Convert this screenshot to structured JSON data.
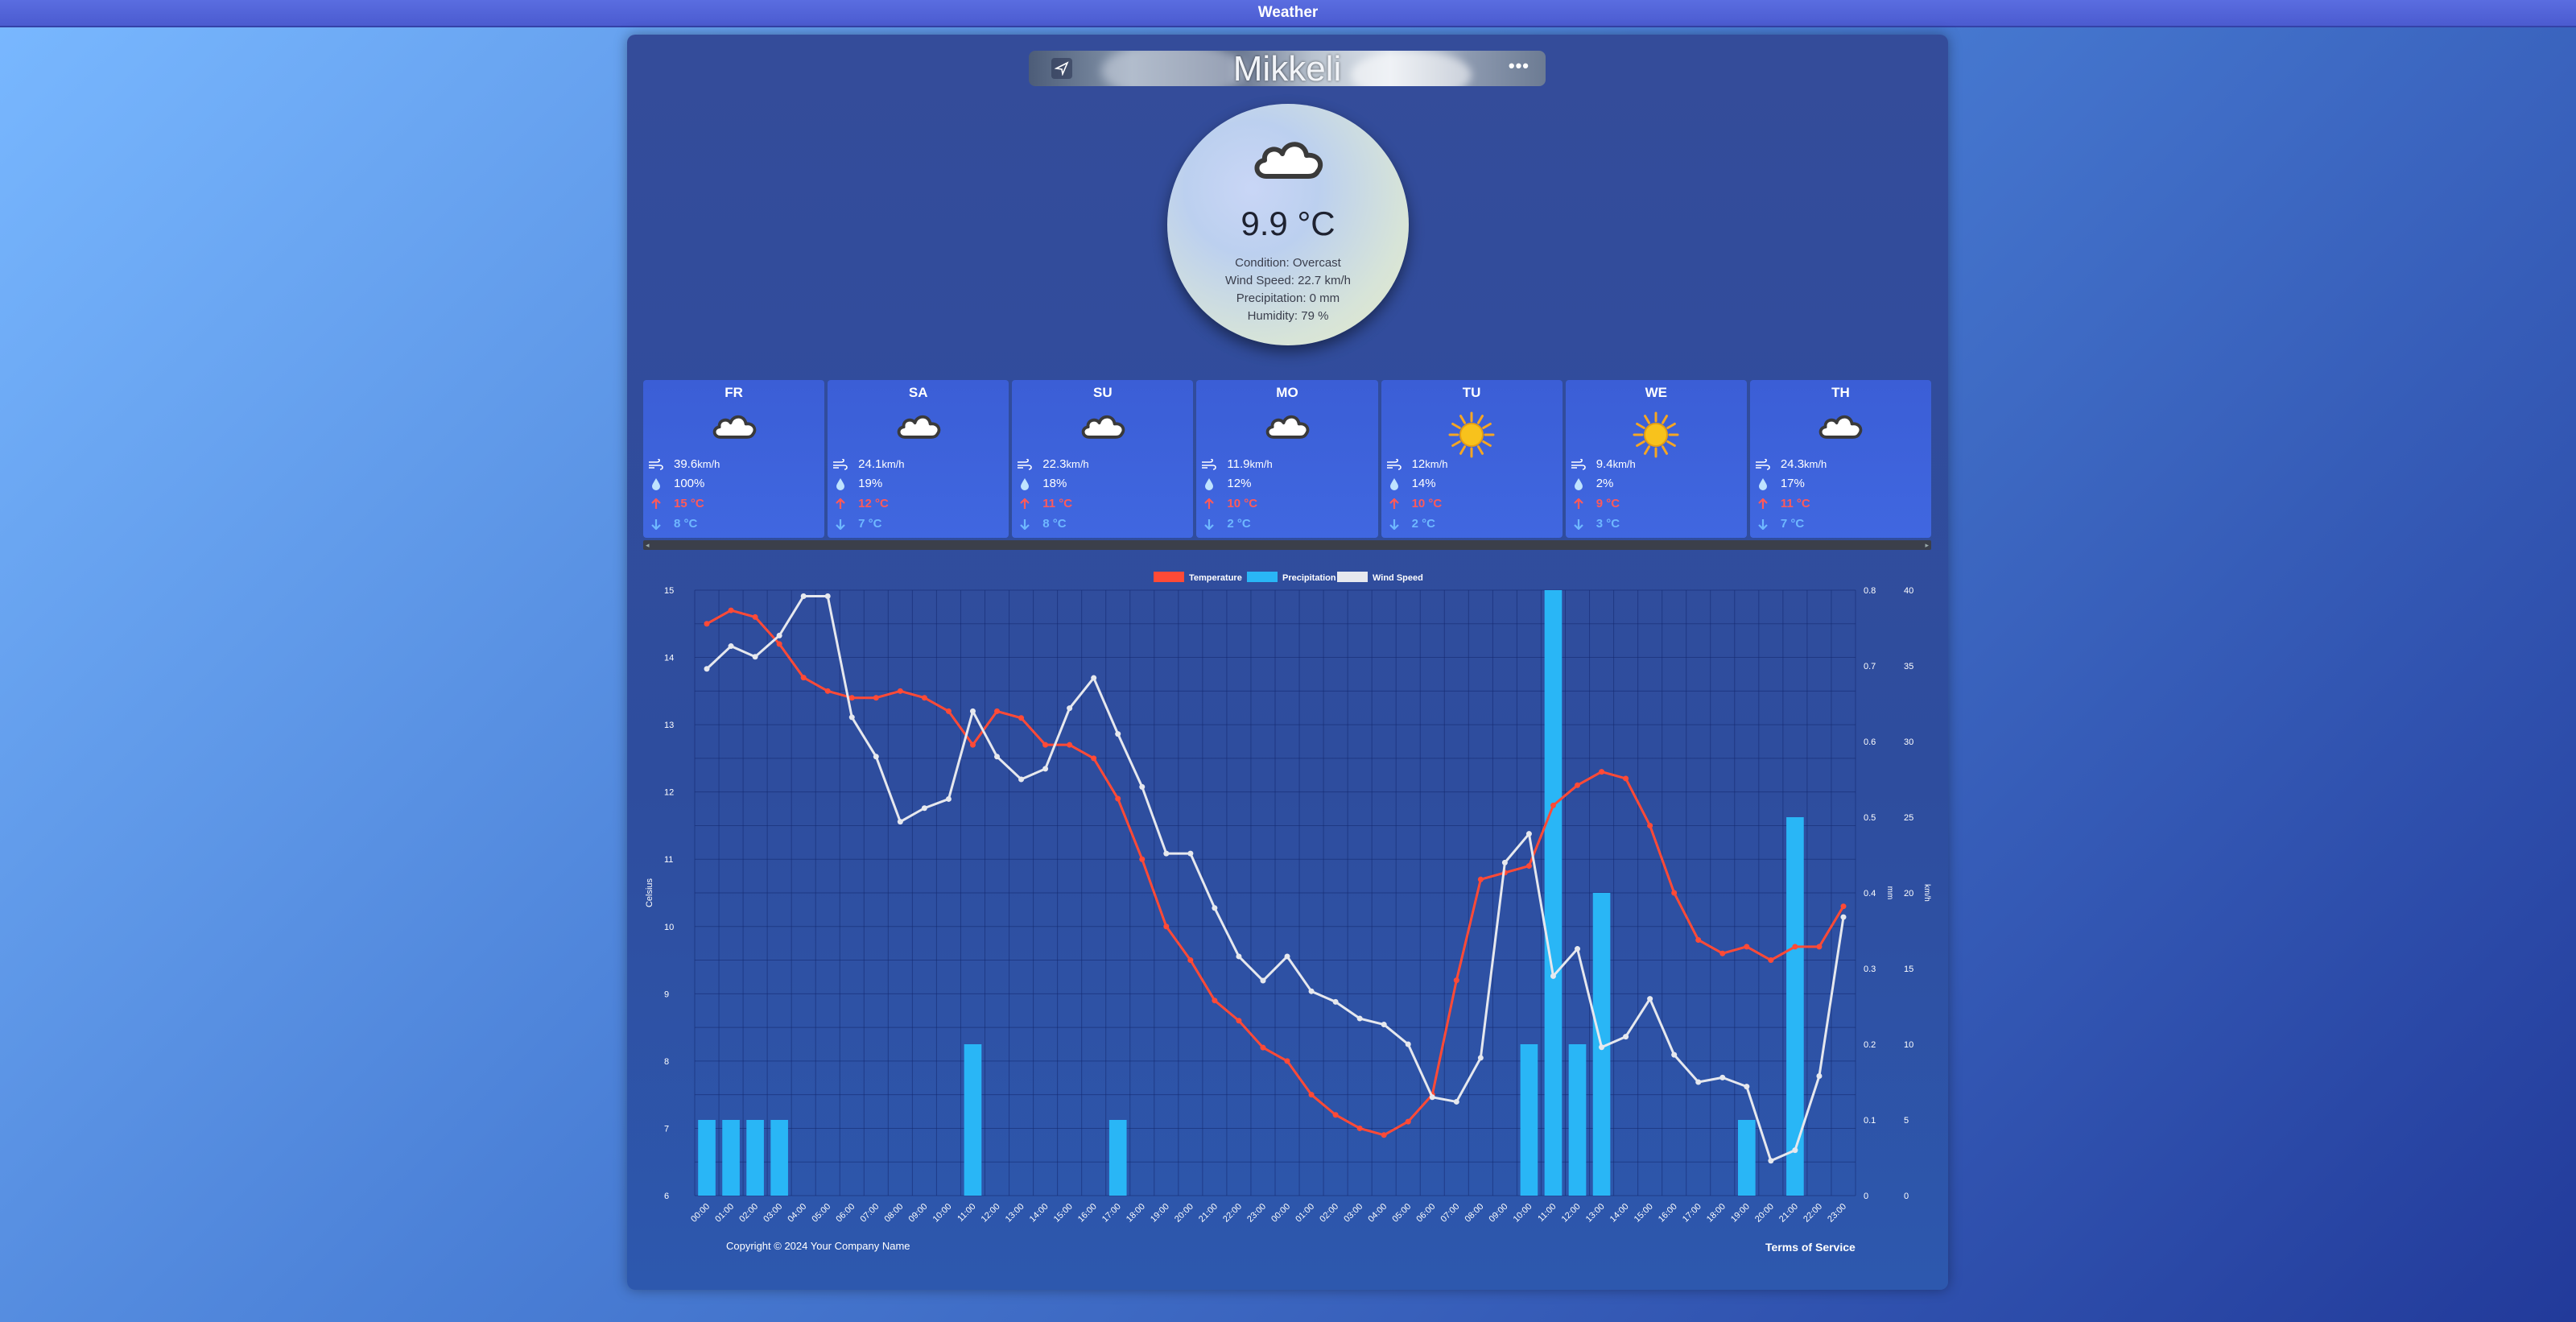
{
  "app": {
    "title": "Weather"
  },
  "search": {
    "city": "Mikkeli"
  },
  "current": {
    "temperature": "9.9 °C",
    "condition": "Condition: Overcast",
    "wind": "Wind Speed: 22.7 km/h",
    "precipitation": "Precipitation: 0 mm",
    "humidity": "Humidity: 79 %",
    "icon": "cloud-icon"
  },
  "forecast": [
    {
      "day": "FR",
      "icon": "cloud-icon",
      "wind": "39.6",
      "wind_unit": "km/h",
      "precip": "100%",
      "high": "15 °C",
      "low": "8 °C"
    },
    {
      "day": "SA",
      "icon": "cloud-icon",
      "wind": "24.1",
      "wind_unit": "km/h",
      "precip": "19%",
      "high": "12 °C",
      "low": "7 °C"
    },
    {
      "day": "SU",
      "icon": "cloud-icon",
      "wind": "22.3",
      "wind_unit": "km/h",
      "precip": "18%",
      "high": "11 °C",
      "low": "8 °C"
    },
    {
      "day": "MO",
      "icon": "cloud-icon",
      "wind": "11.9",
      "wind_unit": "km/h",
      "precip": "12%",
      "high": "10 °C",
      "low": "2 °C"
    },
    {
      "day": "TU",
      "icon": "sun-icon",
      "wind": "12",
      "wind_unit": "km/h",
      "precip": "14%",
      "high": "10 °C",
      "low": "2 °C"
    },
    {
      "day": "WE",
      "icon": "sun-icon",
      "wind": "9.4",
      "wind_unit": "km/h",
      "precip": "2%",
      "high": "9 °C",
      "low": "3 °C"
    },
    {
      "day": "TH",
      "icon": "cloud-icon",
      "wind": "24.3",
      "wind_unit": "km/h",
      "precip": "17%",
      "high": "11 °C",
      "low": "7 °C"
    }
  ],
  "colors": {
    "temperature": "#ff4a36",
    "precipitation": "#29b6f6",
    "wind": "#e6e8ee",
    "high": "#ff5a5a",
    "low": "#6fb8ff"
  },
  "footer": {
    "copyright": "Copyright © 2024 Your Company Name",
    "terms": "Terms of Service"
  },
  "chart_data": {
    "type": "line",
    "legend": [
      "Temperature",
      "Precipitation",
      "Wind Speed"
    ],
    "legend_position": "top-center",
    "grid": true,
    "x": [
      "00:00",
      "01:00",
      "02:00",
      "03:00",
      "04:00",
      "05:00",
      "06:00",
      "07:00",
      "08:00",
      "09:00",
      "10:00",
      "11:00",
      "12:00",
      "13:00",
      "14:00",
      "15:00",
      "16:00",
      "17:00",
      "18:00",
      "19:00",
      "20:00",
      "21:00",
      "22:00",
      "23:00",
      "00:00",
      "01:00",
      "02:00",
      "03:00",
      "04:00",
      "05:00",
      "06:00",
      "07:00",
      "08:00",
      "09:00",
      "10:00",
      "11:00",
      "12:00",
      "13:00",
      "14:00",
      "15:00",
      "16:00",
      "17:00",
      "18:00",
      "19:00",
      "20:00",
      "21:00",
      "22:00",
      "23:00"
    ],
    "y_left": {
      "label": "Celsius",
      "ylim": [
        6,
        15
      ],
      "ticks": [
        6,
        7,
        8,
        9,
        10,
        11,
        12,
        13,
        14,
        15
      ]
    },
    "y_right1": {
      "label": "mm",
      "ylim": [
        0,
        0.8
      ],
      "ticks": [
        0,
        0.1,
        0.2,
        0.3,
        0.4,
        0.5,
        0.6,
        0.7,
        0.8
      ]
    },
    "y_right2": {
      "label": "km/h",
      "ylim": [
        0,
        40
      ],
      "ticks": [
        0,
        5,
        10,
        15,
        20,
        25,
        30,
        35,
        40
      ]
    },
    "series": [
      {
        "name": "Temperature",
        "axis": "left",
        "values": [
          14.5,
          14.7,
          14.6,
          14.2,
          13.7,
          13.5,
          13.4,
          13.4,
          13.5,
          13.4,
          13.2,
          12.7,
          13.2,
          13.1,
          12.7,
          12.7,
          12.5,
          11.9,
          11.0,
          10.0,
          9.5,
          8.9,
          8.6,
          8.2,
          8.0,
          7.5,
          7.2,
          7.0,
          6.9,
          7.1,
          7.5,
          9.2,
          10.7,
          10.8,
          10.9,
          11.8,
          12.1,
          12.3,
          12.2,
          11.5,
          10.5,
          9.8,
          9.6,
          9.7,
          9.5,
          9.7,
          9.7,
          10.3
        ]
      },
      {
        "name": "Precipitation",
        "axis": "right1",
        "type": "bar",
        "values": [
          0.1,
          0.1,
          0.1,
          0.1,
          0,
          0,
          0,
          0,
          0,
          0,
          0,
          0.2,
          0,
          0,
          0,
          0,
          0,
          0.1,
          0,
          0,
          0,
          0,
          0,
          0,
          0,
          0,
          0,
          0,
          0,
          0,
          0,
          0,
          0,
          0,
          0.2,
          0.8,
          0.2,
          0.4,
          0,
          0,
          0,
          0,
          0,
          0.1,
          0,
          0.5,
          0,
          0
        ]
      },
      {
        "name": "Wind Speed",
        "axis": "right2",
        "values": [
          34.8,
          36.3,
          35.6,
          37.0,
          39.6,
          39.6,
          31.6,
          29.0,
          24.7,
          25.6,
          26.2,
          32.0,
          29.0,
          27.5,
          28.2,
          32.2,
          34.2,
          30.5,
          27.0,
          22.6,
          22.6,
          19.0,
          15.8,
          14.2,
          15.8,
          13.5,
          12.8,
          11.7,
          11.3,
          10.0,
          6.5,
          6.2,
          9.1,
          22.0,
          23.9,
          14.5,
          16.3,
          9.8,
          10.5,
          13.0,
          9.3,
          7.5,
          7.8,
          7.2,
          2.3,
          3.0,
          7.9,
          18.4
        ]
      }
    ]
  }
}
